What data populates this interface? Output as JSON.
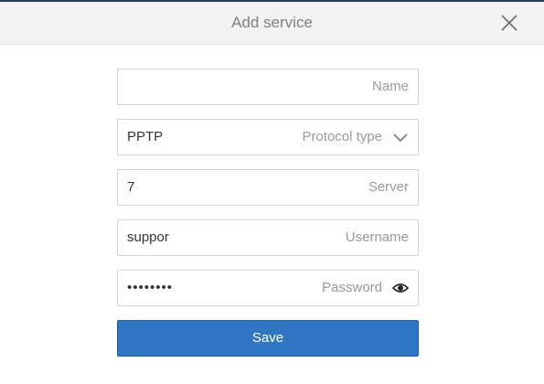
{
  "dialog": {
    "title": "Add service"
  },
  "form": {
    "name": {
      "label": "Name",
      "value": ""
    },
    "protocol_type": {
      "label": "Protocol type",
      "value": "PPTP"
    },
    "server": {
      "label": "Server",
      "value": "7"
    },
    "username": {
      "label": "Username",
      "value": "suppor"
    },
    "password": {
      "label": "Password",
      "value": "••••••••"
    }
  },
  "actions": {
    "save_label": "Save"
  },
  "icons": {
    "close": "close-icon",
    "dropdown": "chevron-down-icon",
    "show_password": "eye-icon"
  },
  "colors": {
    "accent": "#2f76c5",
    "header_bg": "#f2f2f2",
    "top_border": "#2b3a55"
  }
}
